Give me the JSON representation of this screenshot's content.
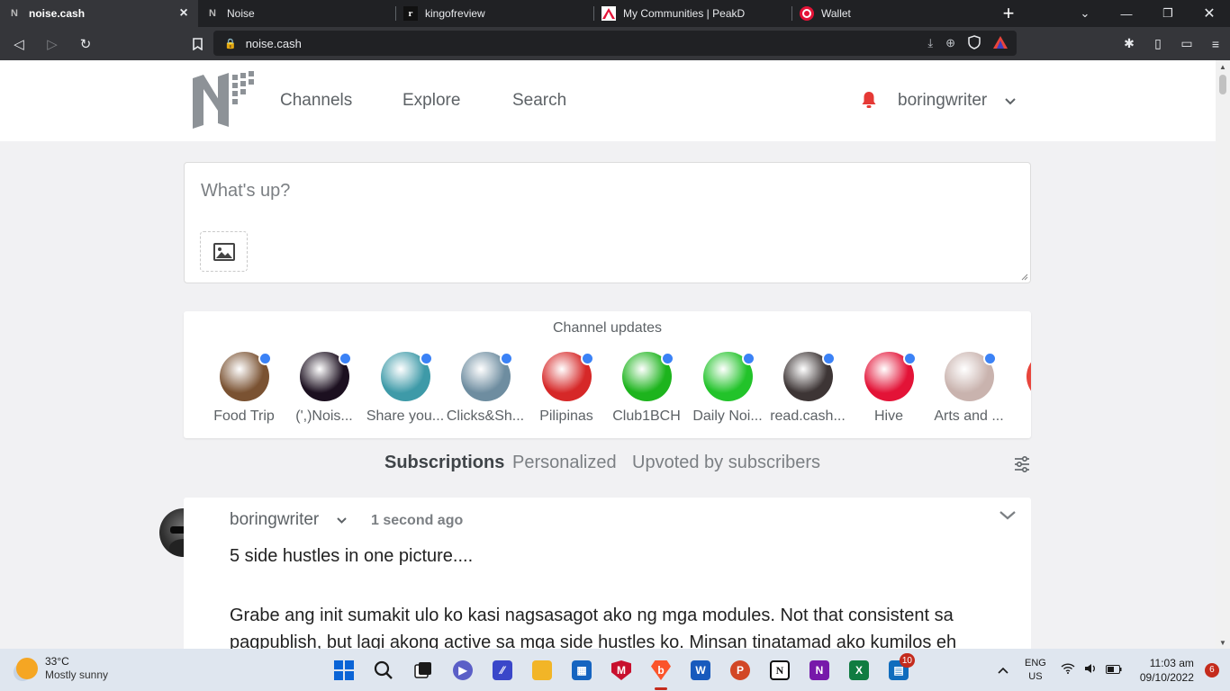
{
  "browser": {
    "tabs": [
      {
        "title": "noise.cash",
        "favicon": "noise-logo-icon",
        "active": true
      },
      {
        "title": "Noise",
        "favicon": "noise-logo-icon",
        "active": false
      },
      {
        "title": "kingofreview",
        "favicon": "kingofreview-icon",
        "active": false
      },
      {
        "title": "My Communities | PeakD",
        "favicon": "peakd-icon",
        "active": false
      },
      {
        "title": "Wallet",
        "favicon": "hive-wallet-icon",
        "active": false
      }
    ],
    "url": "noise.cash"
  },
  "site": {
    "nav": [
      "Channels",
      "Explore",
      "Search"
    ],
    "username": "boringwriter",
    "colors": {
      "accent": "#e53935",
      "dot": "#3b82f6"
    }
  },
  "composer": {
    "placeholder": "What's up?"
  },
  "channels": {
    "heading": "Channel updates",
    "items": [
      {
        "name": "Food Trip",
        "color": "#7a5232"
      },
      {
        "name": "(',)Nois...",
        "color": "#1c1020"
      },
      {
        "name": "Share you...",
        "color": "#3e9aa8"
      },
      {
        "name": "Clicks&Sh...",
        "color": "#6e8da0"
      },
      {
        "name": "Pilipinas",
        "color": "#d62828"
      },
      {
        "name": "Club1BCH",
        "color": "#1db41d"
      },
      {
        "name": "Daily Noi...",
        "color": "#22c32a"
      },
      {
        "name": "read.cash...",
        "color": "#3d3535"
      },
      {
        "name": "Hive",
        "color": "#e31337"
      },
      {
        "name": "Arts and ...",
        "color": "#c9b3ae"
      }
    ]
  },
  "feed": {
    "tabs": [
      "Subscriptions",
      "Personalized",
      "Upvoted by subscribers"
    ],
    "active_tab": "Subscriptions"
  },
  "post": {
    "author": "boringwriter",
    "time": "1 second ago",
    "line1": "5 side hustles in one picture....",
    "line2": "Grabe ang init sumakit ulo ko kasi nagsasagot ako ng mga modules. Not that consistent sa pagpublish, but lagi akong active sa mga side hustles ko. Minsan tinatamad ako kumilos eh"
  },
  "taskbar": {
    "weather_temp": "33°C",
    "weather_desc": "Mostly sunny",
    "lang": "ENG",
    "region": "US",
    "time": "11:03 am",
    "date": "09/10/2022",
    "store_badge": "10",
    "notifications": "6"
  }
}
